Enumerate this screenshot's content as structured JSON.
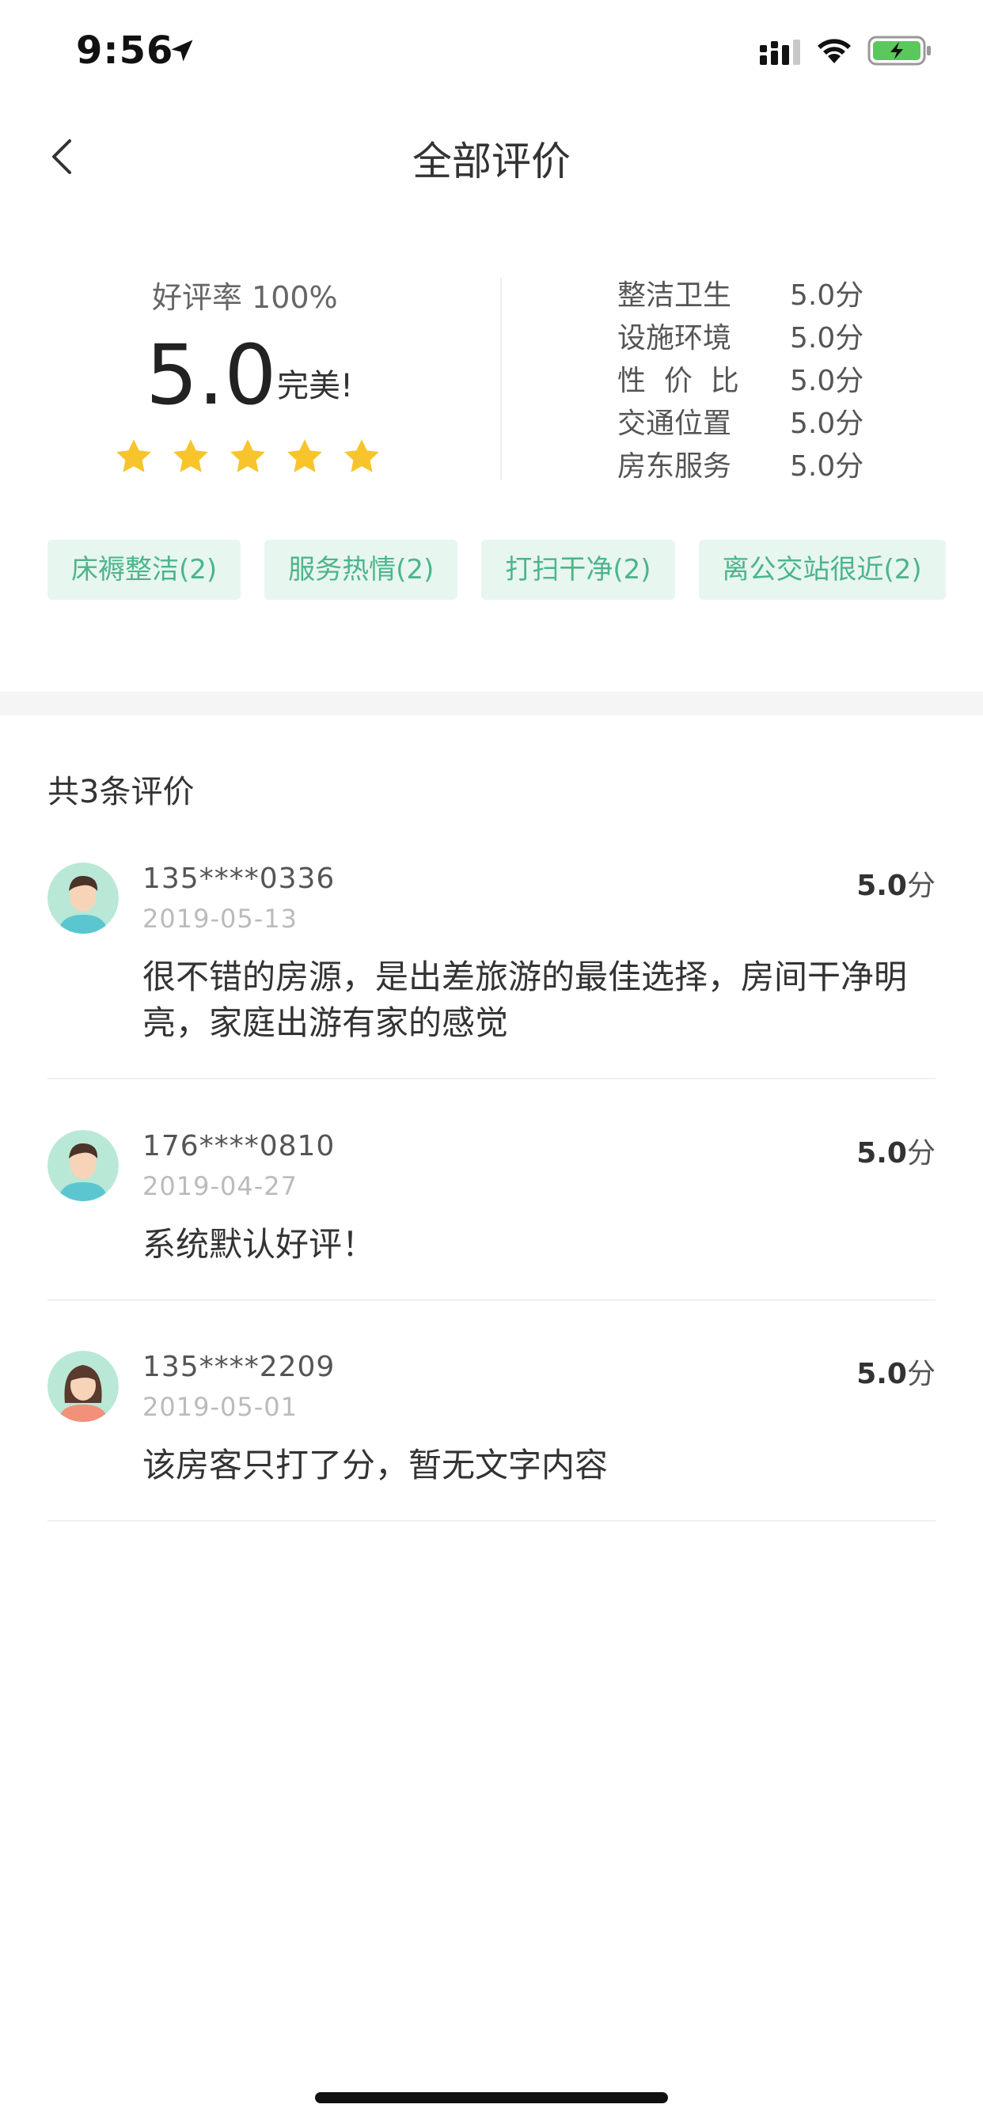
{
  "status_bar": {
    "time": "9:56",
    "icons": [
      "location-arrow-icon",
      "cellular-signal-icon",
      "wifi-icon",
      "battery-charging-icon"
    ]
  },
  "nav": {
    "back_icon": "chevron-left-icon",
    "title": "全部评价"
  },
  "summary": {
    "good_rate_label": "好评率",
    "good_rate_value": "100%",
    "overall_score": "5.0",
    "overall_text": "完美!",
    "star_rating": 5,
    "star_max": 5,
    "sub_scores": [
      {
        "label": "整洁卫生",
        "score": "5.0分"
      },
      {
        "label": "设施环境",
        "score": "5.0分"
      },
      {
        "label": "性  价  比",
        "score": "5.0分"
      },
      {
        "label": "交通位置",
        "score": "5.0分"
      },
      {
        "label": "房东服务",
        "score": "5.0分"
      }
    ]
  },
  "tags": [
    {
      "label": "床褥整洁(2)"
    },
    {
      "label": "服务热情(2)"
    },
    {
      "label": "打扫干净(2)"
    },
    {
      "label": "离公交站很近(2)"
    }
  ],
  "reviews_header": {
    "total_label": "共3条评价"
  },
  "reviews": [
    {
      "user": "135****0336",
      "date": "2019-05-13",
      "score_value": "5.0",
      "score_unit": "分",
      "text": "很不错的房源，是出差旅游的最佳选择，房间干净明亮，家庭出游有家的感觉",
      "avatar": "male-avatar-icon"
    },
    {
      "user": "176****0810",
      "date": "2019-04-27",
      "score_value": "5.0",
      "score_unit": "分",
      "text": "系统默认好评！",
      "avatar": "male-avatar-icon"
    },
    {
      "user": "135****2209",
      "date": "2019-05-01",
      "score_value": "5.0",
      "score_unit": "分",
      "text": "该房客只打了分，暂无文字内容",
      "avatar": "female-avatar-icon"
    }
  ],
  "colors": {
    "accent_green": "#4cb58a",
    "tag_bg": "#e8f6f0",
    "star_yellow": "#f7c52b",
    "battery_green": "#5ac85a"
  }
}
